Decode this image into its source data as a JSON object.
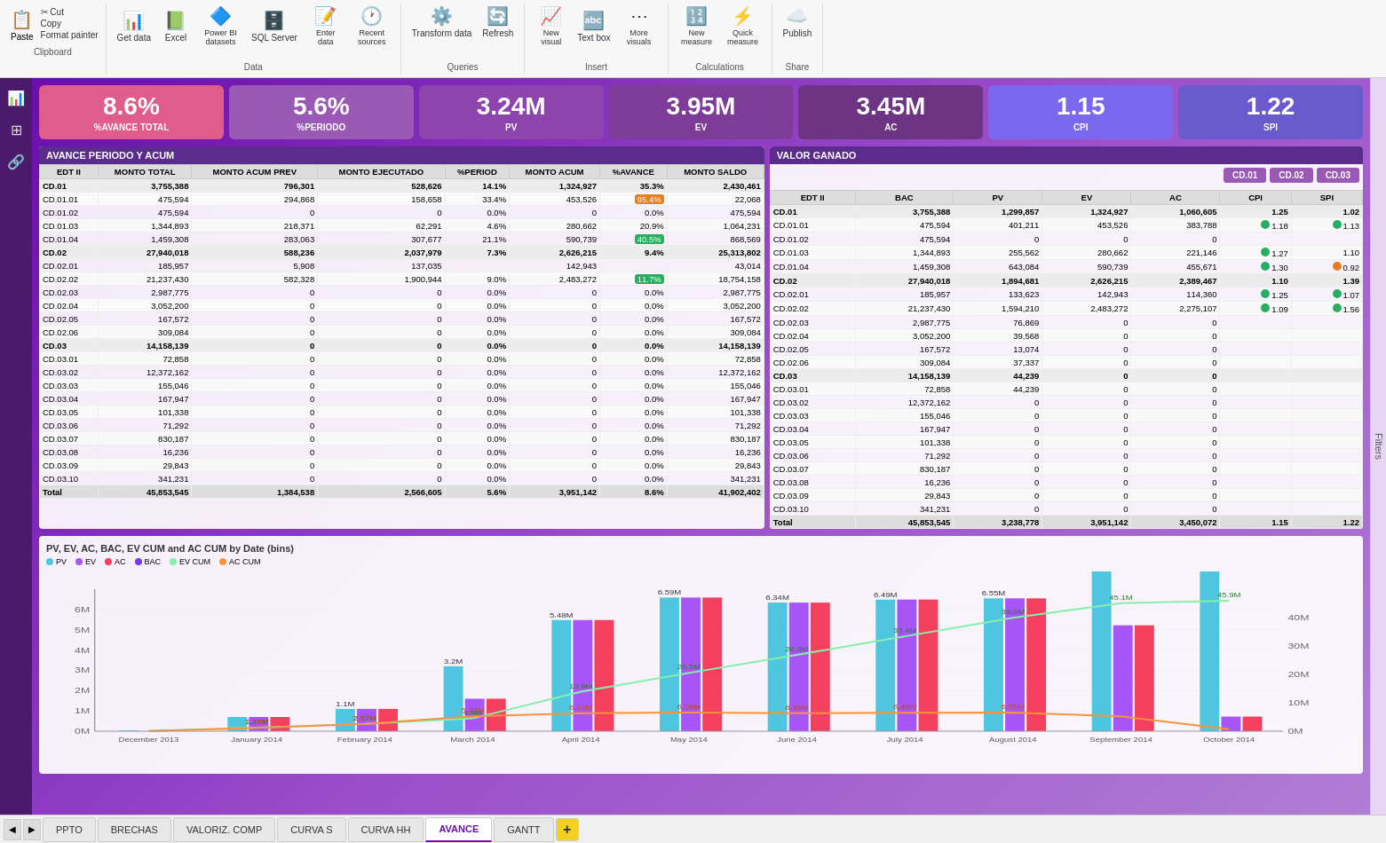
{
  "toolbar": {
    "clipboard_label": "Clipboard",
    "data_label": "Data",
    "queries_label": "Queries",
    "insert_label": "Insert",
    "calculations_label": "Calculations",
    "share_label": "Share",
    "paste_label": "Paste",
    "cut_label": "✂ Cut",
    "copy_label": "Copy",
    "format_painter_label": "Format painter",
    "get_data_label": "Get data",
    "excel_label": "Excel",
    "power_bi_label": "Power BI datasets",
    "sql_label": "SQL Server",
    "enter_data_label": "Enter data",
    "recent_sources_label": "Recent sources",
    "transform_label": "Transform data",
    "refresh_label": "Refresh",
    "new_visual_label": "New visual",
    "text_box_label": "Text box",
    "more_visuals_label": "More visuals",
    "new_measure_label": "New measure",
    "quick_measure_label": "Quick measure",
    "publish_label": "Publish"
  },
  "kpis": [
    {
      "value": "8.6%",
      "label": "%AVANCE TOTAL",
      "style": "kpi-pink"
    },
    {
      "value": "5.6%",
      "label": "%PERIODO",
      "style": "kpi-purple-light"
    },
    {
      "value": "3.24M",
      "label": "PV",
      "style": "kpi-purple-mid"
    },
    {
      "value": "3.95M",
      "label": "EV",
      "style": "kpi-purple-dark"
    },
    {
      "value": "3.45M",
      "label": "AC",
      "style": "kpi-purple-darker"
    },
    {
      "value": "1.15",
      "label": "CPI",
      "style": "kpi-blue-purple"
    },
    {
      "value": "1.22",
      "label": "SPI",
      "style": "kpi-blue-purple2"
    }
  ],
  "avance_table": {
    "title": "AVANCE PERIODO Y ACUM",
    "headers": [
      "EDT II",
      "MONTO TOTAL",
      "MONTO ACUM PREV",
      "MONTO EJECUTADO",
      "%PERIOD",
      "MONTO ACUM",
      "%AVANCE",
      "MONTO SALDO"
    ],
    "rows": [
      {
        "id": "CD.01",
        "total": "3,755,388",
        "acum_prev": "796,301",
        "ejecutado": "528,626",
        "period": "14.1%",
        "acum": "1,324,927",
        "avance": "35.3%",
        "saldo": "2,430,461",
        "bold": true,
        "avance_color": ""
      },
      {
        "id": "CD.01.01",
        "total": "475,594",
        "acum_prev": "294,868",
        "ejecutado": "158,658",
        "period": "33.4%",
        "acum": "453,526",
        "avance": "95.4%",
        "saldo": "22,068",
        "bold": false,
        "avance_color": "badge-orange"
      },
      {
        "id": "CD.01.02",
        "total": "475,594",
        "acum_prev": "0",
        "ejecutado": "0",
        "period": "0.0%",
        "acum": "0",
        "avance": "0.0%",
        "saldo": "475,594",
        "bold": false,
        "avance_color": ""
      },
      {
        "id": "CD.01.03",
        "total": "1,344,893",
        "acum_prev": "218,371",
        "ejecutado": "62,291",
        "period": "4.6%",
        "acum": "280,662",
        "avance": "20.9%",
        "saldo": "1,064,231",
        "bold": false,
        "avance_color": ""
      },
      {
        "id": "CD.01.04",
        "total": "1,459,308",
        "acum_prev": "283,063",
        "ejecutado": "307,677",
        "period": "21.1%",
        "acum": "590,739",
        "avance": "40.5%",
        "saldo": "868,569",
        "bold": false,
        "avance_color": "badge-green"
      },
      {
        "id": "CD.02",
        "total": "27,940,018",
        "acum_prev": "588,236",
        "ejecutado": "2,037,979",
        "period": "7.3%",
        "acum": "2,626,215",
        "avance": "9.4%",
        "saldo": "25,313,802",
        "bold": true,
        "avance_color": ""
      },
      {
        "id": "CD.02.01",
        "total": "185,957",
        "acum_prev": "5,908",
        "ejecutado": "137,035",
        "period": "",
        "acum": "142,943",
        "avance": "",
        "saldo": "43,014",
        "bold": false,
        "avance_color": ""
      },
      {
        "id": "CD.02.02",
        "total": "21,237,430",
        "acum_prev": "582,328",
        "ejecutado": "1,900,944",
        "period": "9.0%",
        "acum": "2,483,272",
        "avance": "11.7%",
        "saldo": "18,754,158",
        "bold": false,
        "avance_color": "badge-green"
      },
      {
        "id": "CD.02.03",
        "total": "2,987,775",
        "acum_prev": "0",
        "ejecutado": "0",
        "period": "0.0%",
        "acum": "0",
        "avance": "0.0%",
        "saldo": "2,987,775",
        "bold": false,
        "avance_color": ""
      },
      {
        "id": "CD.02.04",
        "total": "3,052,200",
        "acum_prev": "0",
        "ejecutado": "0",
        "period": "0.0%",
        "acum": "0",
        "avance": "0.0%",
        "saldo": "3,052,200",
        "bold": false,
        "avance_color": ""
      },
      {
        "id": "CD.02.05",
        "total": "167,572",
        "acum_prev": "0",
        "ejecutado": "0",
        "period": "0.0%",
        "acum": "0",
        "avance": "0.0%",
        "saldo": "167,572",
        "bold": false,
        "avance_color": ""
      },
      {
        "id": "CD.02.06",
        "total": "309,084",
        "acum_prev": "0",
        "ejecutado": "0",
        "period": "0.0%",
        "acum": "0",
        "avance": "0.0%",
        "saldo": "309,084",
        "bold": false,
        "avance_color": ""
      },
      {
        "id": "CD.03",
        "total": "14,158,139",
        "acum_prev": "0",
        "ejecutado": "0",
        "period": "0.0%",
        "acum": "0",
        "avance": "0.0%",
        "saldo": "14,158,139",
        "bold": true,
        "avance_color": ""
      },
      {
        "id": "CD.03.01",
        "total": "72,858",
        "acum_prev": "0",
        "ejecutado": "0",
        "period": "0.0%",
        "acum": "0",
        "avance": "0.0%",
        "saldo": "72,858",
        "bold": false,
        "avance_color": ""
      },
      {
        "id": "CD.03.02",
        "total": "12,372,162",
        "acum_prev": "0",
        "ejecutado": "0",
        "period": "0.0%",
        "acum": "0",
        "avance": "0.0%",
        "saldo": "12,372,162",
        "bold": false,
        "avance_color": ""
      },
      {
        "id": "CD.03.03",
        "total": "155,046",
        "acum_prev": "0",
        "ejecutado": "0",
        "period": "0.0%",
        "acum": "0",
        "avance": "0.0%",
        "saldo": "155,046",
        "bold": false,
        "avance_color": ""
      },
      {
        "id": "CD.03.04",
        "total": "167,947",
        "acum_prev": "0",
        "ejecutado": "0",
        "period": "0.0%",
        "acum": "0",
        "avance": "0.0%",
        "saldo": "167,947",
        "bold": false,
        "avance_color": ""
      },
      {
        "id": "CD.03.05",
        "total": "101,338",
        "acum_prev": "0",
        "ejecutado": "0",
        "period": "0.0%",
        "acum": "0",
        "avance": "0.0%",
        "saldo": "101,338",
        "bold": false,
        "avance_color": ""
      },
      {
        "id": "CD.03.06",
        "total": "71,292",
        "acum_prev": "0",
        "ejecutado": "0",
        "period": "0.0%",
        "acum": "0",
        "avance": "0.0%",
        "saldo": "71,292",
        "bold": false,
        "avance_color": ""
      },
      {
        "id": "CD.03.07",
        "total": "830,187",
        "acum_prev": "0",
        "ejecutado": "0",
        "period": "0.0%",
        "acum": "0",
        "avance": "0.0%",
        "saldo": "830,187",
        "bold": false,
        "avance_color": ""
      },
      {
        "id": "CD.03.08",
        "total": "16,236",
        "acum_prev": "0",
        "ejecutado": "0",
        "period": "0.0%",
        "acum": "0",
        "avance": "0.0%",
        "saldo": "16,236",
        "bold": false,
        "avance_color": ""
      },
      {
        "id": "CD.03.09",
        "total": "29,843",
        "acum_prev": "0",
        "ejecutado": "0",
        "period": "0.0%",
        "acum": "0",
        "avance": "0.0%",
        "saldo": "29,843",
        "bold": false,
        "avance_color": ""
      },
      {
        "id": "CD.03.10",
        "total": "341,231",
        "acum_prev": "0",
        "ejecutado": "0",
        "period": "0.0%",
        "acum": "0",
        "avance": "0.0%",
        "saldo": "341,231",
        "bold": false,
        "avance_color": ""
      },
      {
        "id": "Total",
        "total": "45,853,545",
        "acum_prev": "1,384,538",
        "ejecutado": "2,566,605",
        "period": "5.6%",
        "acum": "3,951,142",
        "avance": "8.6%",
        "saldo": "41,902,402",
        "bold": true,
        "avance_color": ""
      }
    ]
  },
  "valor_ganado_table": {
    "title": "VALOR GANADO",
    "cd_buttons": [
      "CD.01",
      "CD.02",
      "CD.03"
    ],
    "headers": [
      "EDT II",
      "BAC",
      "PV",
      "EV",
      "AC",
      "CPI",
      "SPI"
    ],
    "rows": [
      {
        "id": "CD.01",
        "bac": "3,755,388",
        "pv": "1,299,857",
        "ev": "1,324,927",
        "ac": "1,060,605",
        "cpi": "1.25",
        "spi": "1.02",
        "bold": true,
        "cpi_dot": "",
        "spi_dot": ""
      },
      {
        "id": "CD.01.01",
        "bac": "475,594",
        "pv": "401,211",
        "ev": "453,526",
        "ac": "383,788",
        "cpi": "1.18",
        "spi": "1.13",
        "bold": false,
        "cpi_dot": "green",
        "spi_dot": "green"
      },
      {
        "id": "CD.01.02",
        "bac": "475,594",
        "pv": "0",
        "ev": "0",
        "ac": "0",
        "cpi": "",
        "spi": "",
        "bold": false,
        "cpi_dot": "",
        "spi_dot": ""
      },
      {
        "id": "CD.01.03",
        "bac": "1,344,893",
        "pv": "255,562",
        "ev": "280,662",
        "ac": "221,146",
        "cpi": "1.27",
        "spi": "1.10",
        "bold": false,
        "cpi_dot": "green",
        "spi_dot": ""
      },
      {
        "id": "CD.01.04",
        "bac": "1,459,308",
        "pv": "643,084",
        "ev": "590,739",
        "ac": "455,671",
        "cpi": "1.30",
        "spi": "0.92",
        "bold": false,
        "cpi_dot": "green",
        "spi_dot": "orange"
      },
      {
        "id": "CD.02",
        "bac": "27,940,018",
        "pv": "1,894,681",
        "ev": "2,626,215",
        "ac": "2,389,467",
        "cpi": "1.10",
        "spi": "1.39",
        "bold": true,
        "cpi_dot": "",
        "spi_dot": ""
      },
      {
        "id": "CD.02.01",
        "bac": "185,957",
        "pv": "133,623",
        "ev": "142,943",
        "ac": "114,360",
        "cpi": "1.25",
        "spi": "1.07",
        "bold": false,
        "cpi_dot": "green",
        "spi_dot": "green"
      },
      {
        "id": "CD.02.02",
        "bac": "21,237,430",
        "pv": "1,594,210",
        "ev": "2,483,272",
        "ac": "2,275,107",
        "cpi": "1.09",
        "spi": "1.56",
        "bold": false,
        "cpi_dot": "green",
        "spi_dot": "green"
      },
      {
        "id": "CD.02.03",
        "bac": "2,987,775",
        "pv": "76,869",
        "ev": "0",
        "ac": "0",
        "cpi": "",
        "spi": "",
        "bold": false,
        "cpi_dot": "",
        "spi_dot": ""
      },
      {
        "id": "CD.02.04",
        "bac": "3,052,200",
        "pv": "39,568",
        "ev": "0",
        "ac": "0",
        "cpi": "",
        "spi": "",
        "bold": false,
        "cpi_dot": "",
        "spi_dot": ""
      },
      {
        "id": "CD.02.05",
        "bac": "167,572",
        "pv": "13,074",
        "ev": "0",
        "ac": "0",
        "cpi": "",
        "spi": "",
        "bold": false,
        "cpi_dot": "",
        "spi_dot": ""
      },
      {
        "id": "CD.02.06",
        "bac": "309,084",
        "pv": "37,337",
        "ev": "0",
        "ac": "0",
        "cpi": "",
        "spi": "",
        "bold": false,
        "cpi_dot": "",
        "spi_dot": ""
      },
      {
        "id": "CD.03",
        "bac": "14,158,139",
        "pv": "44,239",
        "ev": "0",
        "ac": "0",
        "cpi": "",
        "spi": "",
        "bold": true,
        "cpi_dot": "",
        "spi_dot": ""
      },
      {
        "id": "CD.03.01",
        "bac": "72,858",
        "pv": "44,239",
        "ev": "0",
        "ac": "0",
        "cpi": "",
        "spi": "",
        "bold": false,
        "cpi_dot": "",
        "spi_dot": ""
      },
      {
        "id": "CD.03.02",
        "bac": "12,372,162",
        "pv": "0",
        "ev": "0",
        "ac": "0",
        "cpi": "",
        "spi": "",
        "bold": false,
        "cpi_dot": "",
        "spi_dot": ""
      },
      {
        "id": "CD.03.03",
        "bac": "155,046",
        "pv": "0",
        "ev": "0",
        "ac": "0",
        "cpi": "",
        "spi": "",
        "bold": false,
        "cpi_dot": "",
        "spi_dot": ""
      },
      {
        "id": "CD.03.04",
        "bac": "167,947",
        "pv": "0",
        "ev": "0",
        "ac": "0",
        "cpi": "",
        "spi": "",
        "bold": false,
        "cpi_dot": "",
        "spi_dot": ""
      },
      {
        "id": "CD.03.05",
        "bac": "101,338",
        "pv": "0",
        "ev": "0",
        "ac": "0",
        "cpi": "",
        "spi": "",
        "bold": false,
        "cpi_dot": "",
        "spi_dot": ""
      },
      {
        "id": "CD.03.06",
        "bac": "71,292",
        "pv": "0",
        "ev": "0",
        "ac": "0",
        "cpi": "",
        "spi": "",
        "bold": false,
        "cpi_dot": "",
        "spi_dot": ""
      },
      {
        "id": "CD.03.07",
        "bac": "830,187",
        "pv": "0",
        "ev": "0",
        "ac": "0",
        "cpi": "",
        "spi": "",
        "bold": false,
        "cpi_dot": "",
        "spi_dot": ""
      },
      {
        "id": "CD.03.08",
        "bac": "16,236",
        "pv": "0",
        "ev": "0",
        "ac": "0",
        "cpi": "",
        "spi": "",
        "bold": false,
        "cpi_dot": "",
        "spi_dot": ""
      },
      {
        "id": "CD.03.09",
        "bac": "29,843",
        "pv": "0",
        "ev": "0",
        "ac": "0",
        "cpi": "",
        "spi": "",
        "bold": false,
        "cpi_dot": "",
        "spi_dot": ""
      },
      {
        "id": "CD.03.10",
        "bac": "341,231",
        "pv": "0",
        "ev": "0",
        "ac": "0",
        "cpi": "",
        "spi": "",
        "bold": false,
        "cpi_dot": "",
        "spi_dot": ""
      },
      {
        "id": "Total",
        "bac": "45,853,545",
        "pv": "3,238,778",
        "ev": "3,951,142",
        "ac": "3,450,072",
        "cpi": "1.15",
        "spi": "1.22",
        "bold": true,
        "cpi_dot": "",
        "spi_dot": ""
      }
    ]
  },
  "chart": {
    "title": "PV, EV, AC, BAC, EV CUM and AC CUM by Date (bins)",
    "legend": [
      {
        "label": "PV",
        "color": "#4ec6e0"
      },
      {
        "label": "EV",
        "color": "#a855f7"
      },
      {
        "label": "AC",
        "color": "#f43f5e"
      },
      {
        "label": "BAC",
        "color": "#7c3aed"
      },
      {
        "label": "EV CUM",
        "color": "#86efac"
      },
      {
        "label": "AC CUM",
        "color": "#fb923c"
      }
    ],
    "bars": [
      {
        "month": "December 2013",
        "pv": 0.04,
        "ev": 0,
        "ac": 0,
        "bac": 0,
        "ev_cum": 0.04,
        "ac_cum": 0.04
      },
      {
        "month": "January 2014",
        "pv": 0.7,
        "ev": 0.7,
        "ac": 0.7,
        "bac": 0,
        "ev_cum": 1.27,
        "ac_cum": 1.2
      },
      {
        "month": "February 2014",
        "pv": 1.1,
        "ev": 1.1,
        "ac": 1.1,
        "bac": 0,
        "ev_cum": 2.57,
        "ac_cum": 2.57
      },
      {
        "month": "March 2014",
        "pv": 3.2,
        "ev": 1.6,
        "ac": 1.6,
        "bac": 0,
        "ev_cum": 4.5,
        "ac_cum": 5.22
      },
      {
        "month": "April 2014",
        "pv": 5.48,
        "ev": 5.48,
        "ac": 5.48,
        "bac": 0,
        "ev_cum": 13.9,
        "ac_cum": 6.34
      },
      {
        "month": "May 2014",
        "pv": 6.59,
        "ev": 6.59,
        "ac": 6.59,
        "bac": 0,
        "ev_cum": 20.5,
        "ac_cum": 6.59
      },
      {
        "month": "June 2014",
        "pv": 6.34,
        "ev": 6.34,
        "ac": 6.34,
        "bac": 0,
        "ev_cum": 26.9,
        "ac_cum": 6.34
      },
      {
        "month": "July 2014",
        "pv": 6.49,
        "ev": 6.49,
        "ac": 6.49,
        "bac": 0,
        "ev_cum": 33.4,
        "ac_cum": 6.49
      },
      {
        "month": "August 2014",
        "pv": 6.55,
        "ev": 6.55,
        "ac": 6.55,
        "bac": 0,
        "ev_cum": 39.9,
        "ac_cum": 6.55
      },
      {
        "month": "September 2014",
        "pv": 45.1,
        "ev": 5.22,
        "ac": 5.22,
        "bac": 0,
        "ev_cum": 45.1,
        "ac_cum": 5.22
      },
      {
        "month": "October 2014",
        "pv": 45.9,
        "ev": 0.72,
        "ac": 0.72,
        "bac": 0,
        "ev_cum": 45.9,
        "ac_cum": 0.72
      }
    ]
  },
  "bottom_tabs": {
    "items": [
      "PPTO",
      "BRECHAS",
      "VALORIZ. COMP",
      "CURVA S",
      "CURVA HH",
      "AVANCE",
      "GANTT"
    ],
    "active": "AVANCE",
    "add_label": "+"
  },
  "filters_label": "Filters"
}
